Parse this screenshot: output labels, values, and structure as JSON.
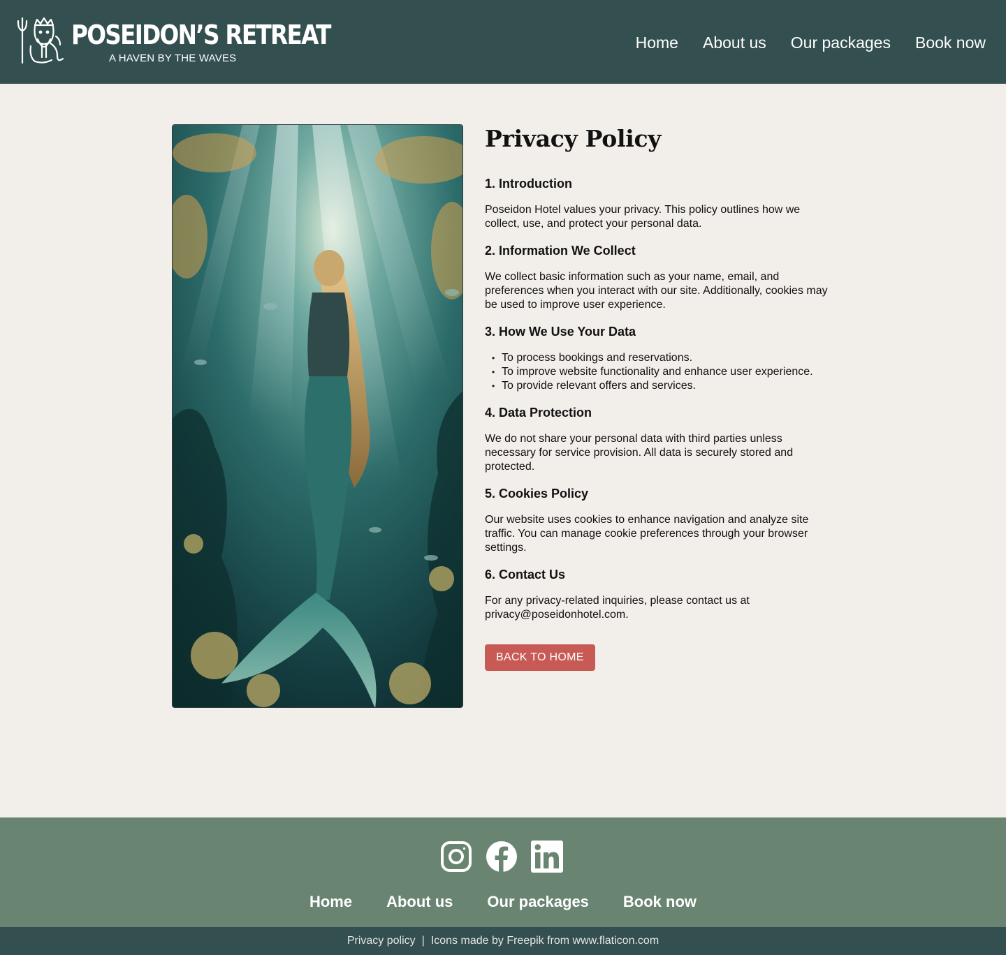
{
  "header": {
    "brand_name": "POSEIDON’S RETREAT",
    "tagline": "A HAVEN BY THE WAVES",
    "logo_icon": "poseidon-trident-icon",
    "nav": [
      "Home",
      "About us",
      "Our packages",
      "Book now"
    ],
    "background": "#344f4f"
  },
  "main": {
    "image_subject": "mermaid-underwater-image",
    "title": "Privacy Policy",
    "sections": [
      {
        "heading": "1. Introduction",
        "text": "Poseidon Hotel values your privacy. This policy outlines how we collect, use, and protect your personal data."
      },
      {
        "heading": "2. Information We Collect",
        "text": "We collect basic information such as your name, email, and preferences when you interact with our site. Additionally, cookies may be used to improve user experience."
      },
      {
        "heading": "3. How We Use Your Data",
        "list": [
          "To process bookings and reservations.",
          "To improve website functionality and enhance user experience.",
          "To provide relevant offers and services."
        ]
      },
      {
        "heading": "4. Data Protection",
        "text": "We do not share your personal data with third parties unless necessary for service provision. All data is securely stored and protected."
      },
      {
        "heading": "5. Cookies Policy",
        "text": "Our website uses cookies to enhance navigation and analyze site traffic. You can manage cookie preferences through your browser settings."
      },
      {
        "heading": "6. Contact Us",
        "text": "For any privacy-related inquiries, please contact us at privacy@poseidonhotel.com."
      }
    ],
    "back_button": "BACK TO HOME",
    "button_color": "#c85a55",
    "background": "#f2eee9"
  },
  "footer": {
    "social": [
      "instagram-icon",
      "facebook-icon",
      "linkedin-icon"
    ],
    "nav": [
      "Home",
      "About us",
      "Our packages",
      "Book now"
    ],
    "background": "#698471",
    "bottom_left": "Privacy policy",
    "separator": "|",
    "bottom_right": "Icons made by Freepik from www.flaticon.com",
    "bottom_background": "#344f4f"
  }
}
